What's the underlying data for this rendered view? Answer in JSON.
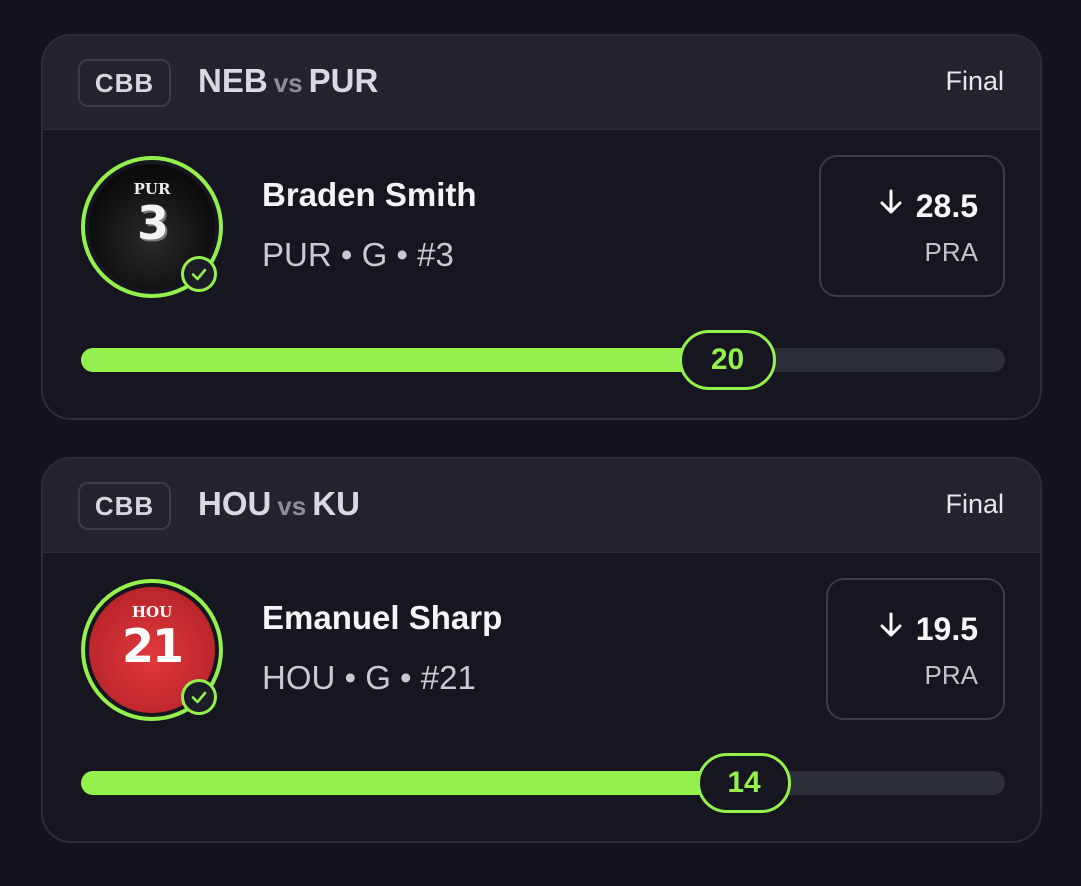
{
  "cards": [
    {
      "league": "CBB",
      "home": "NEB",
      "vs": "vs",
      "away": "PUR",
      "status": "Final",
      "player": {
        "name": "Braden Smith",
        "meta": "PUR • G • #3",
        "jersey_team": "PUR",
        "jersey_number": "3",
        "jersey_color": "#111111",
        "jersey_text_color": "#f2f2f2"
      },
      "direction_icon": "arrow-down-icon",
      "line": "28.5",
      "stat": "PRA",
      "actual": 20,
      "progress": 0.7
    },
    {
      "league": "CBB",
      "home": "HOU",
      "vs": "vs",
      "away": "KU",
      "status": "Final",
      "player": {
        "name": "Emanuel Sharp",
        "meta": "HOU • G • #21",
        "jersey_team": "HOU",
        "jersey_number": "21",
        "jersey_color": "#cc2a2f",
        "jersey_text_color": "#ffffff"
      },
      "direction_icon": "arrow-down-icon",
      "line": "19.5",
      "stat": "PRA",
      "actual": 14,
      "progress": 0.718
    }
  ],
  "colors": {
    "accent": "#95f04d",
    "background": "#12131c",
    "card": "#151620",
    "header": "#22232d"
  }
}
